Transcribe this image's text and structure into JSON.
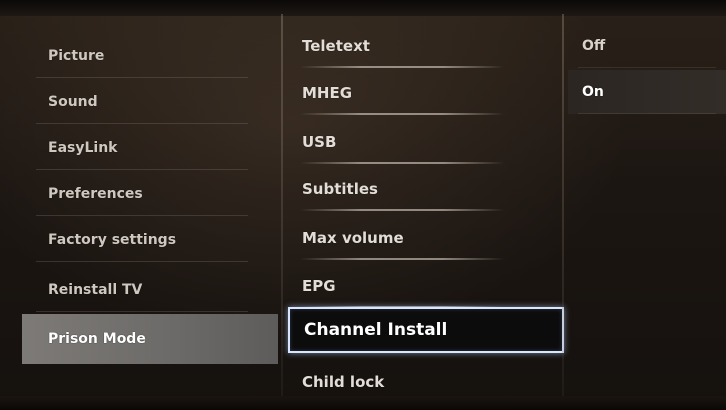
{
  "settings_menu": {
    "categories": [
      {
        "label": "Picture"
      },
      {
        "label": "Sound"
      },
      {
        "label": "EasyLink"
      },
      {
        "label": "Preferences"
      },
      {
        "label": "Factory settings"
      },
      {
        "label": "Reinstall TV"
      },
      {
        "label": "Prison Mode",
        "selected": true
      }
    ]
  },
  "options_menu": {
    "items": [
      {
        "label": "Teletext"
      },
      {
        "label": "MHEG"
      },
      {
        "label": "USB"
      },
      {
        "label": "Subtitles"
      },
      {
        "label": "Max volume"
      },
      {
        "label": "EPG"
      },
      {
        "label": "Channel Install",
        "focused": true
      },
      {
        "label": "Child lock"
      }
    ]
  },
  "value_menu": {
    "items": [
      {
        "label": "Off"
      },
      {
        "label": "On",
        "selected": true
      }
    ]
  },
  "colors": {
    "selected_category_bg": "#7d7a77",
    "focus_border": "#d9e6ff",
    "background": "#1c1612"
  }
}
